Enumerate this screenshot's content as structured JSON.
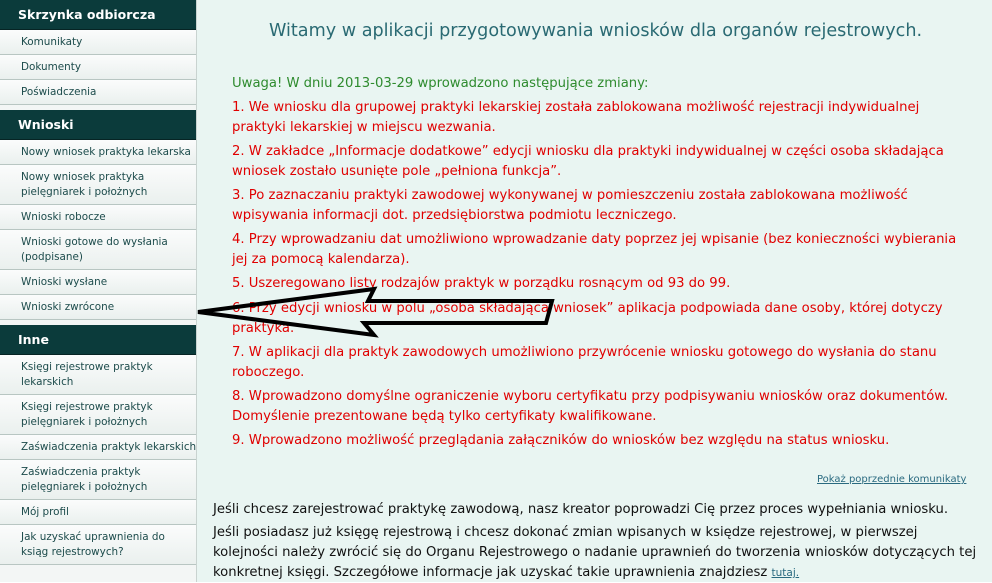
{
  "sidebar": {
    "sections": [
      {
        "title": "Skrzynka odbiorcza",
        "items": [
          "Komunikaty",
          "Dokumenty",
          "Poświadczenia"
        ]
      },
      {
        "title": "Wnioski",
        "items": [
          "Nowy wniosek praktyka lekarska",
          "Nowy wniosek praktyka pielęgniarek i położnych",
          "Wnioski robocze",
          "Wnioski gotowe do wysłania (podpisane)",
          "Wnioski wysłane",
          "Wnioski zwrócone"
        ]
      },
      {
        "title": "Inne",
        "items": [
          "Księgi rejestrowe praktyk lekarskich",
          "Księgi rejestrowe praktyk pielęgniarek i położnych",
          "Zaświadczenia praktyk lekarskich",
          "Zaświadczenia praktyk pielęgniarek i położnych",
          "Mój profil",
          "Jak uzyskać uprawnienia do ksiąg rejestrowych?"
        ]
      }
    ]
  },
  "main": {
    "title": "Witamy w aplikacji przygotowywania wniosków dla organów rejestrowych.",
    "notice_intro": "Uwaga! W dniu 2013-03-29 wprowadzono następujące zmiany:",
    "changes": [
      "1. We wniosku dla grupowej praktyki lekarskiej została zablokowana możliwość rejestracji indywidualnej praktyki lekarskiej w miejscu wezwania.",
      "2. W zakładce „Informacje dodatkowe” edycji wniosku dla praktyki indywidualnej w części osoba składająca wniosek zostało usunięte pole „pełniona funkcja”.",
      "3. Po zaznaczaniu praktyki zawodowej wykonywanej w pomieszczeniu została zablokowana możliwość wpisywania informacji dot. przedsiębiorstwa podmiotu leczniczego.",
      "4. Przy wprowadzaniu dat umożliwiono wprowadzanie daty poprzez jej wpisanie (bez konieczności wybierania jej za pomocą kalendarza).",
      "5. Uszeregowano listy rodzajów praktyk w porządku rosnącym od 93 do 99.",
      "6. Przy edycji wniosku w polu „osoba składająca wniosek” aplikacja podpowiada dane osoby, której dotyczy praktyka.",
      "7. W aplikacji dla praktyk zawodowych umożliwiono przywrócenie wniosku gotowego do wysłania do stanu roboczego.",
      "8. Wprowadzono domyślne ograniczenie wyboru certyfikatu przy podpisywaniu wniosków oraz dokumentów. Domyślenie prezentowane będą tylko certyfikaty kwalifikowane.",
      "9. Wprowadzono możliwość przeglądania załączników do wniosków bez względu na status wniosku."
    ],
    "prev_link": "Pokaż poprzednie komunikaty",
    "info1": "Jeśli chcesz zarejestrować praktykę zawodową, nasz kreator poprowadzi Cię przez proces wypełniania wniosku.",
    "info2": "Jeśli posiadasz już księgę rejestrową i chcesz dokonać zmian wpisanych w księdze rejestrowej, w pierwszej kolejności należy zwrócić się do Organu Rejestrowego o nadanie uprawnień do tworzenia wniosków dotyczących tej konkretnej księgi. Szczegółowe informacje jak uzyskać takie uprawnienia znajdziesz",
    "info2_link": "tutaj."
  }
}
